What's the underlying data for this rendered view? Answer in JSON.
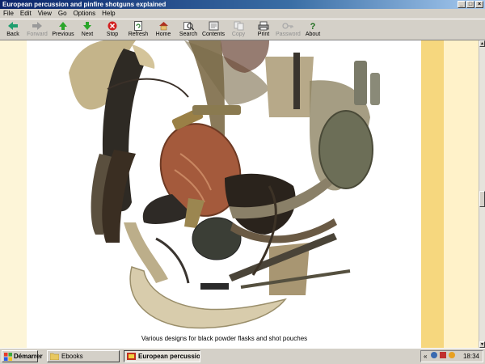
{
  "window": {
    "title": "European percussion and pinfire shotguns explained"
  },
  "menu": [
    "File",
    "Edit",
    "View",
    "Go",
    "Options",
    "Help"
  ],
  "toolbar": {
    "back": "Back",
    "forward": "Forward",
    "previous": "Previous",
    "next": "Next",
    "stop": "Stop",
    "refresh": "Refresh",
    "home": "Home",
    "search": "Search",
    "contents": "Contents",
    "copy": "Copy",
    "print": "Print",
    "password": "Password",
    "about": "About"
  },
  "content": {
    "caption": "Various designs for black powder flasks and shot pouches",
    "colors": {
      "page": "#ffffff",
      "margin": "#fdf5d8",
      "stripe_dark": "#f6d77e",
      "stripe_light": "#fff2c9"
    }
  },
  "taskbar": {
    "start": "Démarrer",
    "tasks": [
      "Ebooks",
      "European percussion ..."
    ],
    "clock": "18:34"
  }
}
